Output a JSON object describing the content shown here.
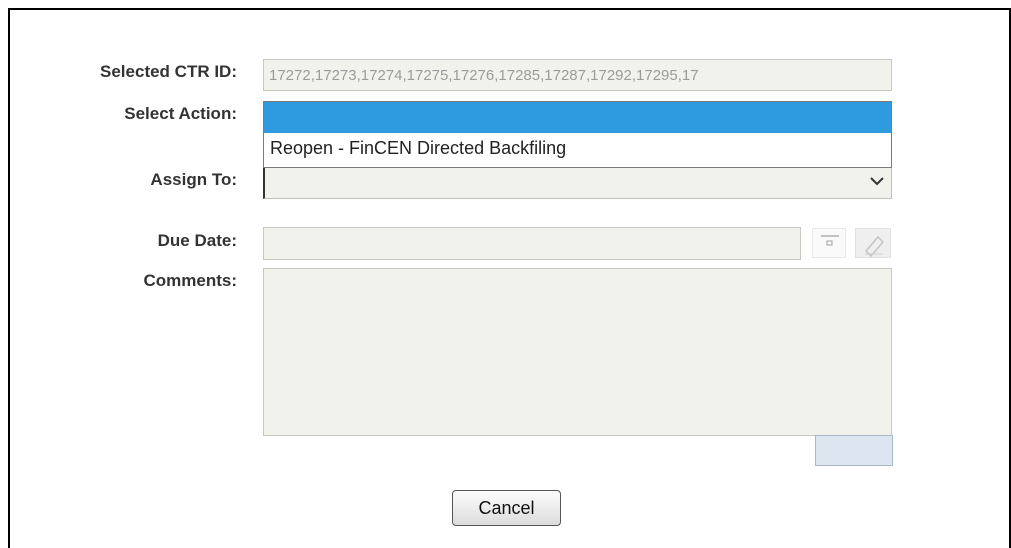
{
  "form": {
    "labels": {
      "selected_ctr_id": "Selected CTR ID:",
      "select_action": "Select Action:",
      "assign_to": "Assign To:",
      "due_date": "Due Date:",
      "comments": "Comments:"
    },
    "selected_ctr_id_value": "17272,17273,17274,17275,17276,17285,17287,17292,17295,17",
    "select_action": {
      "selected_value": "",
      "options": [
        "Reopen - FinCEN Directed Backfiling"
      ],
      "expanded": true,
      "highlight_color": "#2e9bde"
    },
    "assign_to_value": "",
    "due_date_value": "",
    "comments_value": "",
    "icons": {
      "chevron": "chevron-down-icon",
      "calendar": "calendar-icon",
      "clear": "eraser-icon"
    }
  },
  "buttons": {
    "cancel_label": "Cancel"
  }
}
